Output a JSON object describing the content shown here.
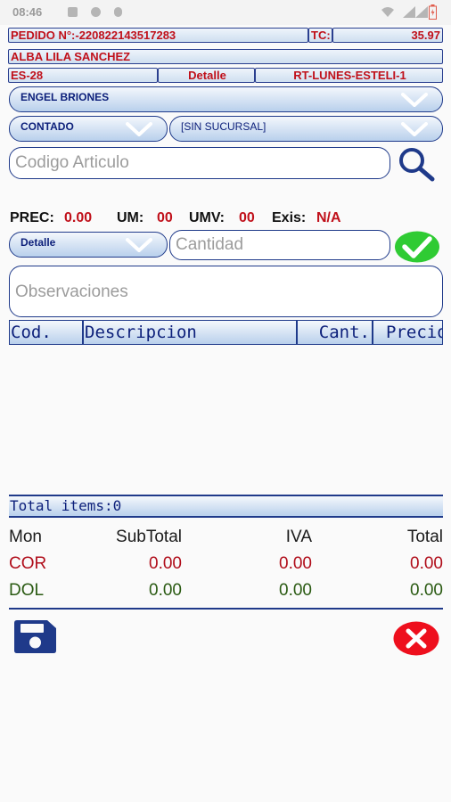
{
  "status_bar": {
    "time": "08:46"
  },
  "header": {
    "pedido_label": "PEDIDO N°:",
    "pedido_number": "-220822143517283",
    "tc_label": "TC:",
    "tc_value": "35.97",
    "client_name": "ALBA LILA SANCHEZ",
    "code": "ES-28",
    "price_type": "Detalle",
    "route": "RT-LUNES-ESTELI-1"
  },
  "seller_select": {
    "value": "ENGEL BRIONES"
  },
  "payment_select": {
    "value": "CONTADO"
  },
  "branch_select": {
    "value": "[SIN SUCURSAL]"
  },
  "article_search": {
    "placeholder": "Codigo Articulo"
  },
  "info_row": {
    "prec_label": "PREC:",
    "prec_value": "0.00",
    "um_label": "UM:",
    "um_value": "00",
    "umv_label": "UMV:",
    "umv_value": "00",
    "exis_label": "Exis:",
    "exis_value": "N/A"
  },
  "unit_select": {
    "value": "Detalle"
  },
  "quantity_input": {
    "placeholder": "Cantidad"
  },
  "observations_input": {
    "placeholder": "Observaciones"
  },
  "table": {
    "columns": [
      "Cod.",
      "Descripcion",
      "Cant.",
      "Precio"
    ]
  },
  "total_items": "Total items:0",
  "totals": {
    "headers": [
      "Mon",
      "SubTotal",
      "IVA",
      "Total"
    ],
    "rows": [
      {
        "currency": "COR",
        "subtotal": "0.00",
        "iva": "0.00",
        "total": "0.00"
      },
      {
        "currency": "DOL",
        "subtotal": "0.00",
        "iva": "0.00",
        "total": "0.00"
      }
    ]
  },
  "colors": {
    "accent": "#1f3a8a",
    "red": "#c0101a",
    "green": "#2fcb33"
  }
}
